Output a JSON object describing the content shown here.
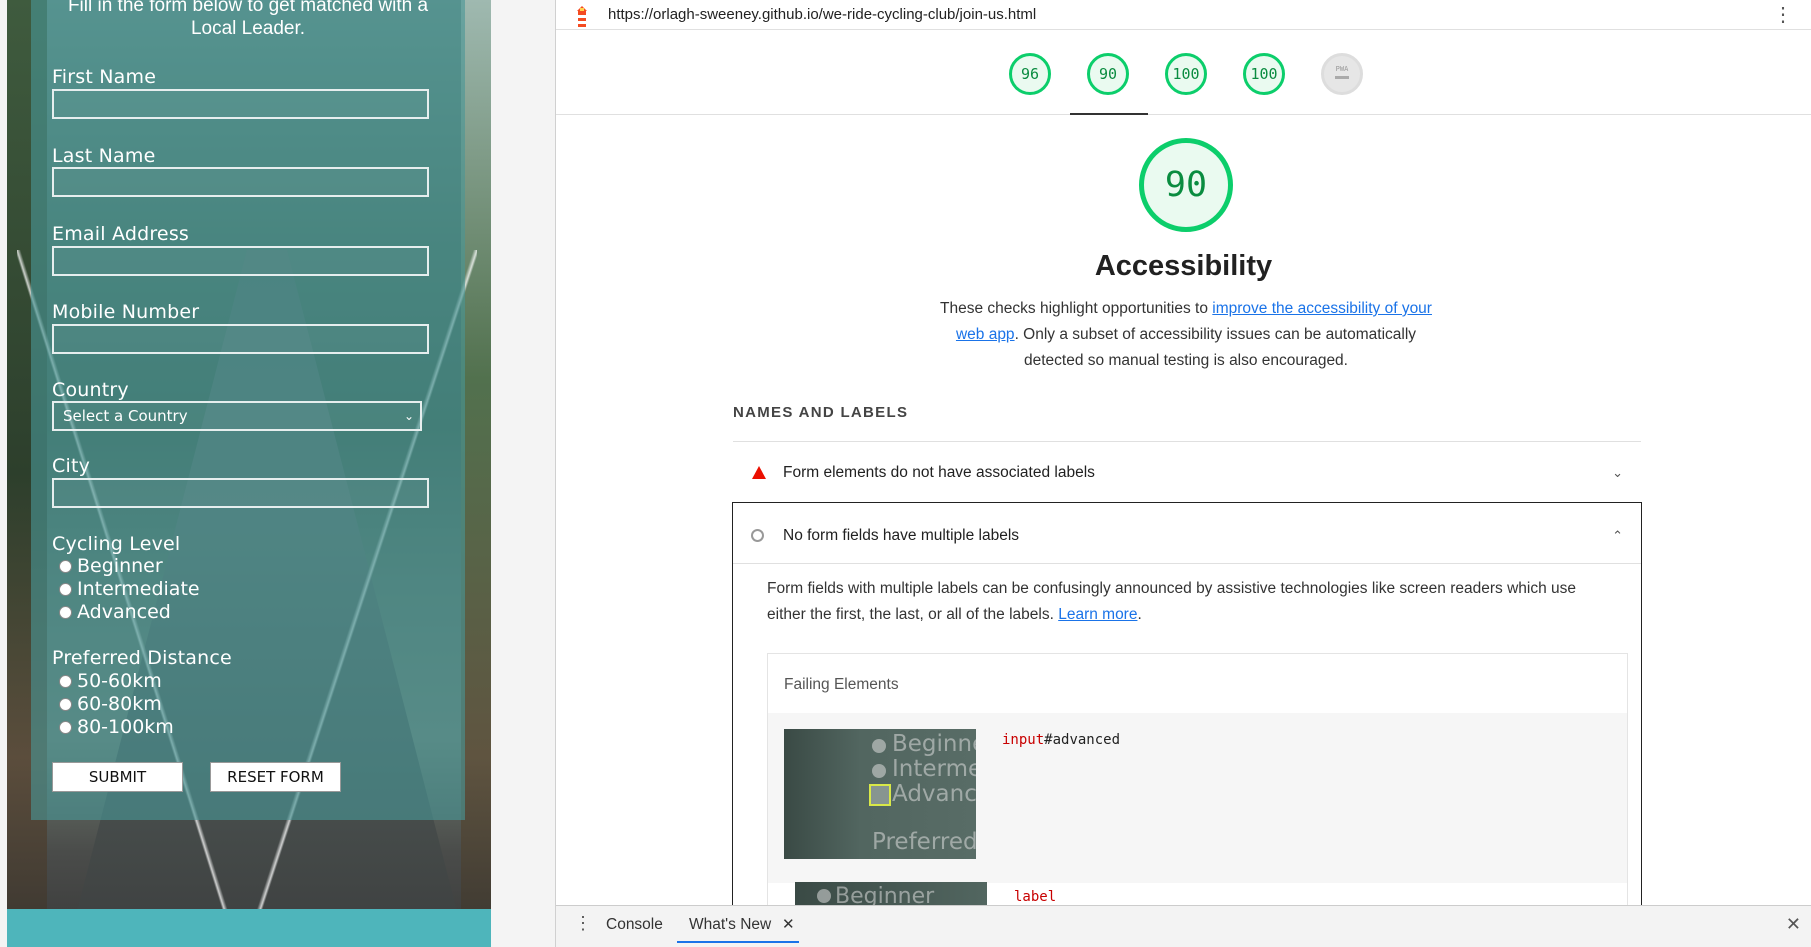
{
  "form": {
    "intro_line1": "Fill in the form below to get matched with a",
    "intro_line2": "Local Leader.",
    "first_name": "First Name",
    "last_name": "Last Name",
    "email": "Email Address",
    "mobile": "Mobile Number",
    "country": "Country",
    "country_select": "Select a Country",
    "city": "City",
    "cycling_level": "Cycling Level",
    "levels": [
      "Beginner",
      "Intermediate",
      "Advanced"
    ],
    "distance": "Preferred Distance",
    "distances": [
      "50-60km",
      "60-80km",
      "80-100km"
    ],
    "submit": "SUBMIT",
    "reset": "RESET FORM"
  },
  "browser": {
    "url": "https://orlagh-sweeney.github.io/we-ride-cycling-club/join-us.html"
  },
  "scores": [
    {
      "value": "96"
    },
    {
      "value": "90"
    },
    {
      "value": "100"
    },
    {
      "value": "100"
    },
    {
      "value": "PWA"
    }
  ],
  "category": {
    "score": "90",
    "title": "Accessibility",
    "desc_before": "These checks highlight opportunities to ",
    "desc_link": "improve the accessibility of your web app",
    "desc_after": ". Only a subset of accessibility issues can be automatically detected so manual testing is also encouraged."
  },
  "group": {
    "title": "NAMES AND LABELS",
    "audits": [
      {
        "title": "Form elements do not have associated labels",
        "status": "fail"
      },
      {
        "title": "No form fields have multiple labels",
        "status": "neutral"
      }
    ],
    "expanded": {
      "desc_before": "Form fields with multiple labels can be confusingly announced by assistive technologies like screen readers which use either the first, the last, or all of the labels. ",
      "learn_more": "Learn more",
      "desc_after": ".",
      "failing_title": "Failing Elements",
      "items": [
        {
          "tag": "input",
          "selector": "#advanced"
        },
        {
          "tag": "label",
          "selector": ""
        }
      ],
      "thumb_texts": [
        "Beginne",
        "Interme",
        "Advance",
        "Preferred"
      ],
      "thumb2_text": "Beginner"
    }
  },
  "drawer": {
    "tabs": [
      "Console",
      "What's New"
    ]
  },
  "colors": {
    "pass": "#0cce6b",
    "fail": "#eb0f00",
    "link": "#1a73e8",
    "teal": "#4eb5bb"
  }
}
